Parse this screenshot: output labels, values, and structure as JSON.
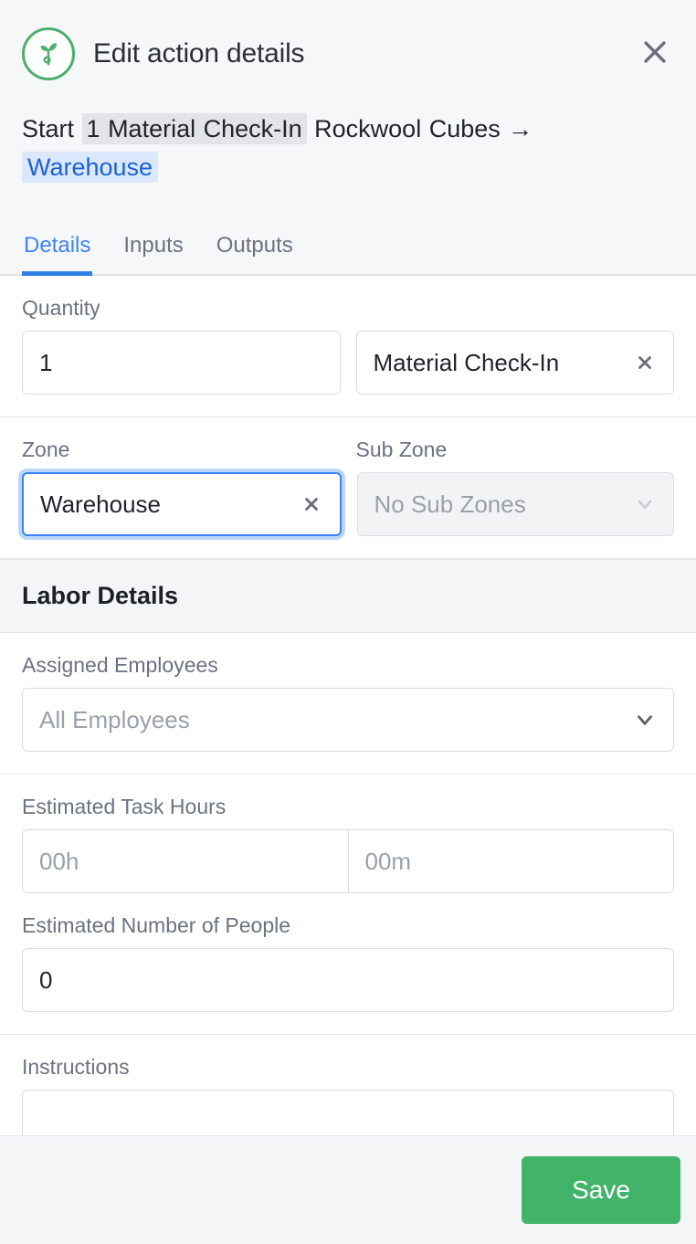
{
  "header": {
    "title": "Edit action details",
    "logo_icon": "sprout-icon",
    "close_icon": "close-icon",
    "breadcrumb": {
      "prefix": "Start",
      "chip": "1 Material Check-In",
      "middle": "Rockwool Cubes",
      "arrow": "→",
      "link": "Warehouse"
    }
  },
  "tabs": [
    {
      "label": "Details",
      "active": true
    },
    {
      "label": "Inputs",
      "active": false
    },
    {
      "label": "Outputs",
      "active": false
    }
  ],
  "quantity_section": {
    "label": "Quantity",
    "quantity_value": "1",
    "action_value": "Material Check-In",
    "clear_icon": "close-icon"
  },
  "zone_section": {
    "zone_label": "Zone",
    "zone_value": "Warehouse",
    "zone_clear_icon": "close-icon",
    "sub_zone_label": "Sub Zone",
    "sub_zone_placeholder": "No Sub Zones",
    "sub_zone_chevron_icon": "chevron-down-icon"
  },
  "labor_details": {
    "title": "Labor Details",
    "assigned_employees_label": "Assigned Employees",
    "assigned_employees_placeholder": "All Employees",
    "assigned_employees_chevron_icon": "chevron-down-icon",
    "task_hours_label": "Estimated Task Hours",
    "hours_placeholder": "00h",
    "minutes_placeholder": "00m",
    "people_label": "Estimated Number of People",
    "people_value": "0",
    "instructions_label": "Instructions"
  },
  "footer": {
    "save_label": "Save"
  },
  "colors": {
    "accent_blue": "#3b82f6",
    "brand_green": "#4caf6e",
    "save_green": "#41b469",
    "link_blue": "#1a62d6",
    "chip_grey": "#e3e4e8",
    "link_bg": "#dbe7fb",
    "panel_grey": "#f4f5f7",
    "border_grey": "#d9dce2",
    "text_dark": "#20242b",
    "text_muted": "#6b7280",
    "placeholder_grey": "#9aa0ab"
  }
}
